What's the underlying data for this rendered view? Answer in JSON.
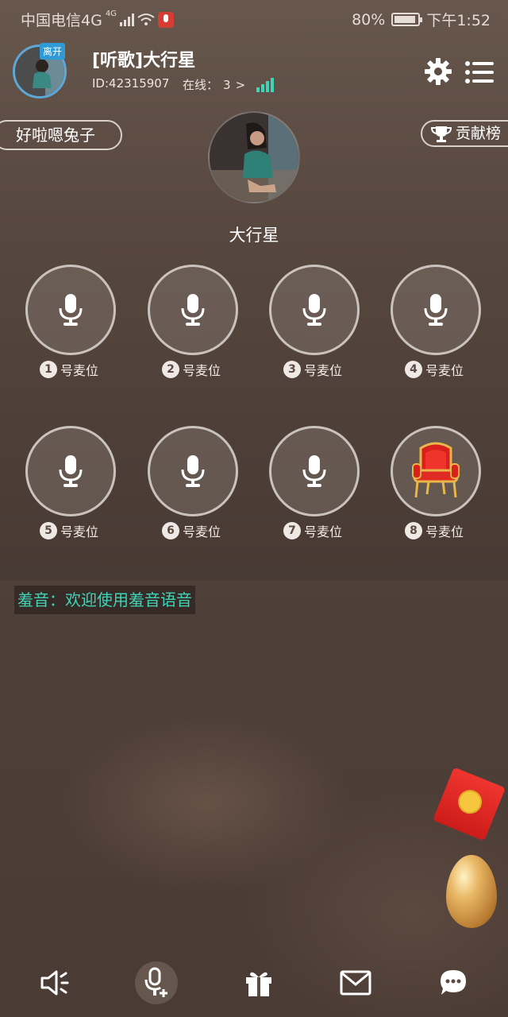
{
  "status_bar": {
    "carrier": "中国电信4G",
    "network_type": "4G",
    "battery": "80%",
    "battery_level": 0.8,
    "time": "下午1:52"
  },
  "header": {
    "away_badge": "离开",
    "room_title": "[听歌]大行星",
    "room_id": "ID:42315907",
    "online_label": "在线：",
    "online_count": "3",
    "online_arrow": ">"
  },
  "nickname_pill": "好啦嗯兔子",
  "ranking_pill": "贡献榜",
  "host": {
    "name": "大行星"
  },
  "seats": [
    {
      "num": "1",
      "label": "号麦位",
      "icon": "microphone-icon"
    },
    {
      "num": "2",
      "label": "号麦位",
      "icon": "microphone-icon"
    },
    {
      "num": "3",
      "label": "号麦位",
      "icon": "microphone-icon"
    },
    {
      "num": "4",
      "label": "号麦位",
      "icon": "microphone-icon"
    },
    {
      "num": "5",
      "label": "号麦位",
      "icon": "microphone-icon"
    },
    {
      "num": "6",
      "label": "号麦位",
      "icon": "microphone-icon"
    },
    {
      "num": "7",
      "label": "号麦位",
      "icon": "microphone-icon"
    },
    {
      "num": "8",
      "label": "号麦位",
      "icon": "red-throne-chair-icon"
    }
  ],
  "system_message": "羞音：欢迎使用羞音语音",
  "bottom_bar": [
    "speaker-icon",
    "mic-add-icon",
    "gift-icon",
    "mail-icon",
    "chat-icon"
  ],
  "colors": {
    "accent": "#3fd4b7",
    "badge_blue": "#2e9ad6",
    "status_red": "#d53c34"
  }
}
